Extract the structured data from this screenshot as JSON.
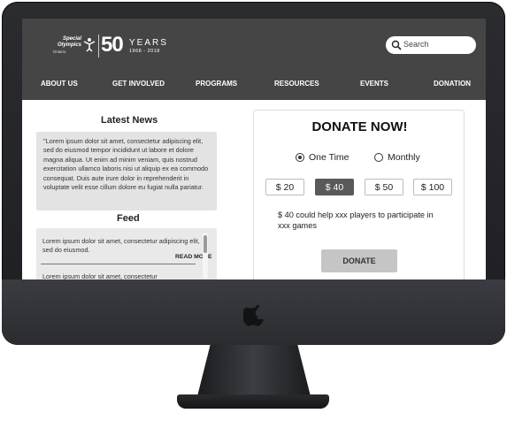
{
  "header": {
    "logo": {
      "org_line1": "Special",
      "org_line2": "Olympics",
      "org_region": "Ontario",
      "anniversary_number": "50",
      "anniversary_word": "YEARS",
      "anniversary_dates": "1968 - 2018"
    },
    "search": {
      "placeholder": "Search"
    },
    "nav": [
      "ABOUT US",
      "GET INVOLVED",
      "PROGRAMS",
      "RESOURCES",
      "EVENTS",
      "DONATION"
    ]
  },
  "news": {
    "title": "Latest News",
    "body": "\"Lorem ipsum dolor sit amet, consectetur adipiscing elit, sed do eiusmod tempor incididunt ut labore et dolore magna aliqua. Ut enim ad minim veniam, quis nostrud exercitation ullamco laboris nisi ut aliquip ex ea commodo consequat. Duis aute irure dolor in reprehenderit in voluptate velit esse cillum dolore eu fugiat nulla pariatur."
  },
  "feed": {
    "title": "Feed",
    "items": [
      {
        "text": "Lorem ipsum dolor sit amet, consectetur adipiscing elit, sed do eiusmod.",
        "link": "READ MORE"
      },
      {
        "text": "Lorem ipsum dolor sit amet, consectetur"
      }
    ]
  },
  "donate": {
    "title": "DONATE NOW!",
    "frequency": [
      {
        "label": "One Time",
        "selected": true
      },
      {
        "label": "Monthly",
        "selected": false
      }
    ],
    "amounts": [
      {
        "label": "$ 20",
        "selected": false
      },
      {
        "label": "$ 40",
        "selected": true
      },
      {
        "label": "$ 50",
        "selected": false
      },
      {
        "label": "$ 100",
        "selected": false
      }
    ],
    "message": "$ 40 could help xxx players to participate in xxx games",
    "button_label": "DONATE"
  },
  "colors": {
    "header_bg": "#454545",
    "selected_amount_bg": "#595959",
    "donate_button_bg": "#c5c5c5",
    "content_box_bg": "#e3e3e3"
  }
}
